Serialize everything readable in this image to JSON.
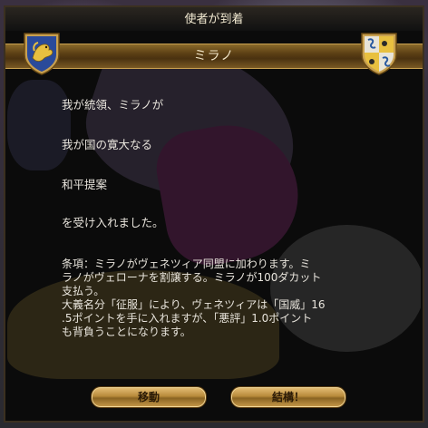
{
  "window": {
    "title": "使者が到着",
    "banner": "ミラノ"
  },
  "message": {
    "line1": "我が統領、ミラノが",
    "line2": "我が国の寛大なる",
    "line3": "和平提案",
    "line4": "を受け入れました。",
    "terms": "条項：ミラノがヴェネツィア同盟に加わります。ミ\nラノがヴェローナを割譲する。ミラノが100ダカット\n支払う。\n大義名分「征服」により、ヴェネツィアは「国威」16\n.5ポイントを手に入れますが、「悪評」1.0ポイント\nも背負うことになります。"
  },
  "buttons": {
    "move_label": "移動",
    "ok_label": "結構！"
  },
  "colors": {
    "accent_gold": "#c8a050",
    "text": "#e8e4dc",
    "banner_brown": "#5a3e14"
  },
  "icons": {
    "left_shield": "venice-lion-shield-icon",
    "right_shield": "milan-serpent-shield-icon"
  }
}
